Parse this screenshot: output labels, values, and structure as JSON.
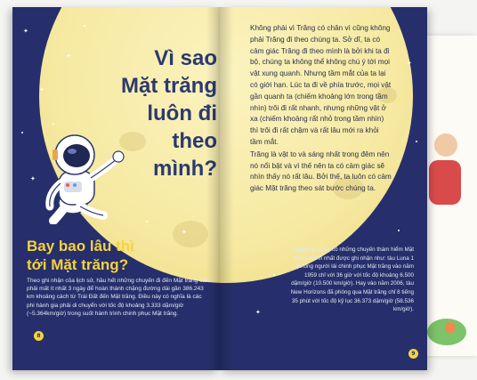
{
  "left_page": {
    "title_lines": [
      "Vì sao",
      "Mặt trăng",
      "luôn đi theo",
      "mình?"
    ],
    "section_title_lines": [
      "Bay bao lâu thì",
      "tới Mặt trăng?"
    ],
    "body": "Theo ghi nhận của lịch sử, hầu hết những chuyến đi đến Mặt trăng cần phải mất ít nhất 3 ngày để hoàn thành chặng đường dài gần 386.243 km khoảng cách từ Trái Đất đến Mặt trăng. Điều này có nghĩa là các phi hành gia phải di chuyển với tốc độ khoảng 3.333 dặm/giờ (~5.364km/giờ) trong suốt hành trình chinh phục Mặt trăng.",
    "page_number": "8",
    "illustration_icon": "astronaut-icon"
  },
  "right_page": {
    "paragraphs": [
      "Không phải vì Trăng có chân vì cũng không phải Trăng đi theo chúng ta. Sở dĩ, ta có cảm giác Trăng đi theo mình là bởi khi ta đi bộ, chúng ta không thể không chú ý tới mọi vật xung quanh. Nhưng tầm mắt của ta lại có giới hạn. Lúc ta đi về phía trước, mọi vật gần quanh ta (chiếm khoảng lớn trong tầm nhìn) trôi đi rất nhanh, nhưng những vật ở xa (chiếm khoảng rất nhỏ trong tầm nhìn) thì trôi đi rất chậm và rất lâu mới ra khỏi tầm mắt.",
      "Trăng là vật to và sáng nhất trong đêm nên nó nổi bật và vì thế nên ta có cảm giác sẽ nhìn thấy nó rất lâu. Bởi thế, ta luôn có cảm giác Mặt trăng theo sát bước chúng ta."
    ],
    "side_note": "Ngoài ra, cũng có những chuyến thám hiểm Mặt trăng thành nhất được ghi nhận như: tàu Luna 1 (không người lái chinh phục Mặt trăng vào năm 1959 chỉ với 36 giờ với tốc độ khoảng 6.500 dặm/giờ (10.500 km/giờ). Hay vào năm 2006, tàu New Horizons đã phóng qua Mặt trăng chỉ 8 tiếng 35 phút với tốc độ kỷ lục 36.373 dặm/giờ (58.536 km/giờ).",
    "page_number": "9"
  },
  "colors": {
    "night_blue": "#262f6b",
    "moon_yellow": "#f6e9a2",
    "title_blue": "#2c3a6e",
    "heading_yellow": "#f5d33c"
  }
}
